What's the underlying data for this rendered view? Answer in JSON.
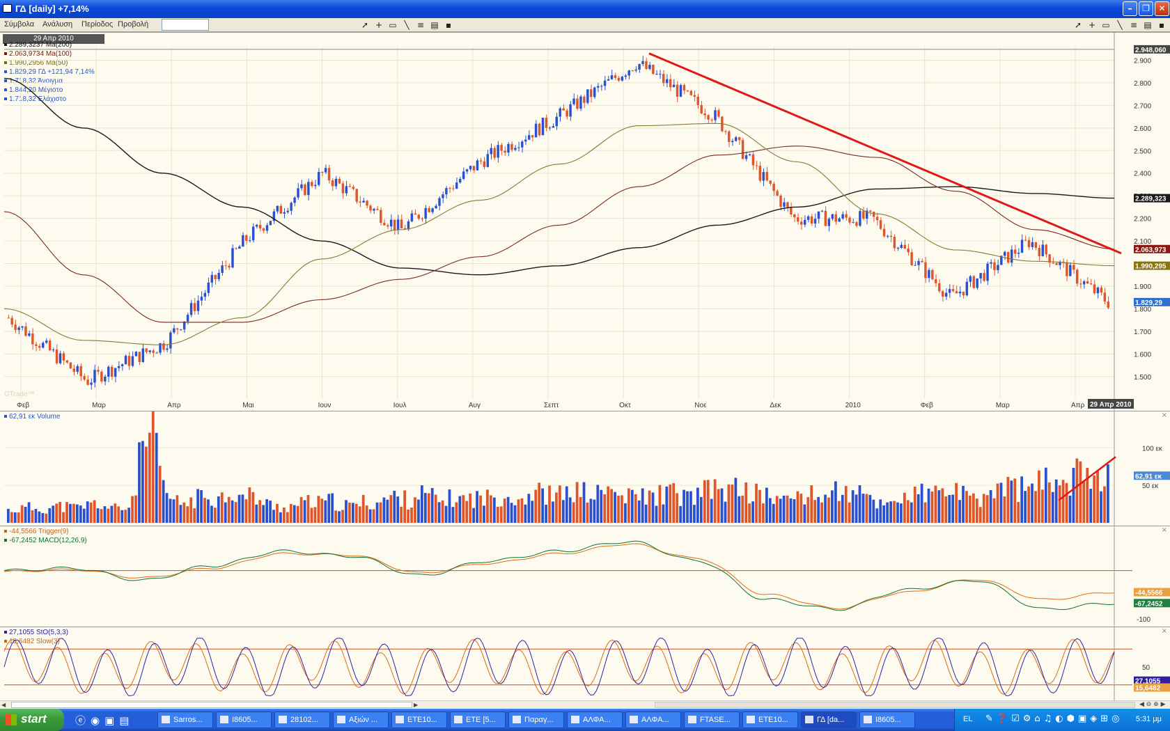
{
  "window": {
    "title": "ΓΔ [daily] +7,14%"
  },
  "menu": {
    "items": [
      "Σύμβολα",
      "Ανάλυση",
      "Περίοδος",
      "Προβολή"
    ],
    "symbol_input": ""
  },
  "main": {
    "date_label": "29 Απρ 2010",
    "legend": [
      {
        "text": "2.289,3237 Ma(200)",
        "color": "#1a1a1a"
      },
      {
        "text": "2.063,9734 Ma(100)",
        "color": "#7a1a12"
      },
      {
        "text": "1.990,2956 Ma(50)",
        "color": "#7a6a10"
      },
      {
        "text": "1.829,29 ΓΔ +121,94 7,14%",
        "color": "#2a55c8"
      },
      {
        "text": "1.718,32 Άνοιγμα",
        "color": "#2a55c8"
      },
      {
        "text": "1.844,20 Μέγιστο",
        "color": "#2a55c8"
      },
      {
        "text": "1.718,32 Ελάχιστο",
        "color": "#2a55c8"
      }
    ],
    "watermark": "GTrade™",
    "ytick_labels": [
      "2.900",
      "2.800",
      "2.700",
      "2.600",
      "2.500",
      "2.400",
      "2.300",
      "2.200",
      "2.100",
      "2.000",
      "1.900",
      "1.800",
      "1.700",
      "1.600",
      "1.500"
    ],
    "xtick_labels": [
      "Φεβ",
      "Μαρ",
      "Απρ",
      "Μαι",
      "Ιουν",
      "Ιουλ",
      "Αυγ",
      "Σεπτ",
      "Οκτ",
      "Νοε",
      "Δεκ",
      "2010",
      "Φεβ",
      "Μαρ",
      "Απρ"
    ],
    "value_tags": [
      {
        "text": "2.948,060",
        "color": "#444444"
      },
      {
        "text": "2.289,323",
        "color": "#1a1a1a"
      },
      {
        "text": "2.063,973",
        "color": "#8b1a14"
      },
      {
        "text": "1.990,295",
        "color": "#8a7410"
      },
      {
        "text": "1.829,29",
        "color": "#2f6fd0"
      }
    ],
    "end_date_tag": "29 Απρ 2010"
  },
  "volume": {
    "legend": "62,91 εκ Volume",
    "ticks": [
      "100 εκ",
      "50 εκ"
    ],
    "tag": "62,91 εκ"
  },
  "macd": {
    "legend": [
      {
        "text": "-44,5566 Trigger(9)",
        "color": "#d06010"
      },
      {
        "text": "-67,2452 MACD(12,26,9)",
        "color": "#107030"
      }
    ],
    "ticks": [
      "-100"
    ],
    "tags": [
      "-44,5566",
      "-67,2452"
    ]
  },
  "stoch": {
    "legend": [
      {
        "text": "27,1055 StO(5,3,3)",
        "color": "#3020a0"
      },
      {
        "text": "15,6482 Slow(3)",
        "color": "#d06010"
      }
    ],
    "ticks": [
      "50"
    ],
    "tags": [
      "27,1055",
      "15,6482"
    ]
  },
  "colors": {
    "up": "#2a50d0",
    "down": "#e0562a",
    "ma200": "#1a1a1a",
    "ma100": "#7a2a20",
    "ma50": "#8a7a30",
    "trend": "#e01818",
    "macd": "#107030",
    "trigger": "#e06a10",
    "sto": "#3020a0",
    "slow": "#e06a10",
    "hline": "#c8501c"
  },
  "chart_data": [
    {
      "type": "candlestick",
      "title": "ΓΔ [daily] +7,14%",
      "ylim": [
        1450,
        2960
      ],
      "x": [
        "2009-02",
        "2009-03",
        "2009-04",
        "2009-05",
        "2009-06",
        "2009-07",
        "2009-08",
        "2009-09",
        "2009-10",
        "2009-11",
        "2009-12",
        "2010-01",
        "2010-02",
        "2010-03",
        "2010-04"
      ],
      "series": [
        {
          "name": "ΓΔ",
          "close": [
            1760,
            1480,
            1650,
            2100,
            2400,
            2150,
            2450,
            2650,
            2890,
            2650,
            2200,
            2200,
            1850,
            2100,
            1829.29
          ]
        },
        {
          "name": "Ma(200)",
          "values": [
            2820,
            2600,
            2400,
            2250,
            2100,
            1980,
            1950,
            1990,
            2070,
            2170,
            2250,
            2330,
            2340,
            2310,
            2289.32
          ]
        },
        {
          "name": "Ma(100)",
          "values": [
            2230,
            1950,
            1740,
            1740,
            1840,
            1930,
            2030,
            2170,
            2340,
            2480,
            2520,
            2470,
            2320,
            2150,
            2063.97
          ]
        },
        {
          "name": "Ma(50)",
          "values": [
            1800,
            1660,
            1640,
            1760,
            2020,
            2150,
            2280,
            2440,
            2610,
            2620,
            2450,
            2220,
            2060,
            2010,
            1990.3
          ]
        }
      ],
      "last": {
        "close": 1829.29,
        "change": 121.94,
        "change_pct": 7.14,
        "open": 1718.32,
        "high": 1844.2,
        "low": 1718.32
      }
    },
    {
      "type": "bar",
      "title": "Volume",
      "ylabel": "εκ",
      "ylim": [
        0,
        130
      ],
      "values": [
        18,
        20,
        22,
        20,
        23,
        24,
        21,
        25,
        28,
        22,
        20,
        23,
        100,
        130,
        45,
        30,
        28,
        35,
        40,
        34,
        47,
        35,
        40,
        28,
        24,
        22,
        26,
        30,
        28,
        32,
        25,
        24,
        30,
        28,
        34,
        38,
        32,
        42,
        38,
        30,
        36,
        33,
        36,
        35,
        38,
        40,
        34,
        42,
        44,
        38,
        40,
        46,
        42,
        40,
        48,
        38,
        36,
        40,
        36,
        44,
        42,
        36,
        40,
        46,
        50,
        44,
        52,
        40,
        42,
        36,
        30,
        42,
        40,
        36,
        44,
        48,
        36,
        42,
        30,
        26,
        38,
        35,
        42,
        40,
        44,
        48,
        38,
        30,
        40,
        46,
        52,
        50,
        48,
        56,
        62,
        60,
        64,
        76,
        82,
        62
      ],
      "last": 62.91
    },
    {
      "type": "line",
      "title": "MACD(12,26,9)",
      "series": [
        {
          "name": "MACD(12,26,9)",
          "values": [
            0,
            5,
            -20,
            10,
            40,
            30,
            -10,
            20,
            40,
            60,
            20,
            -60,
            -80,
            -40,
            -20,
            -80,
            -67.25
          ]
        },
        {
          "name": "Trigger(9)",
          "values": [
            -2,
            2,
            -15,
            5,
            35,
            32,
            -5,
            15,
            35,
            55,
            25,
            -50,
            -78,
            -45,
            -18,
            -60,
            -44.56
          ]
        }
      ]
    },
    {
      "type": "line",
      "title": "StO(5,3,3)",
      "ylim": [
        0,
        100
      ],
      "series": [
        {
          "name": "StO(5,3,3)",
          "values": [
            80,
            30,
            85,
            20,
            90,
            40,
            75,
            15,
            85,
            60,
            25,
            90,
            20,
            80,
            35,
            85,
            10,
            27.11
          ]
        },
        {
          "name": "Slow(3)",
          "values": [
            70,
            45,
            70,
            35,
            80,
            50,
            65,
            25,
            78,
            62,
            35,
            80,
            30,
            72,
            40,
            75,
            20,
            15.65
          ]
        }
      ]
    }
  ]
}
